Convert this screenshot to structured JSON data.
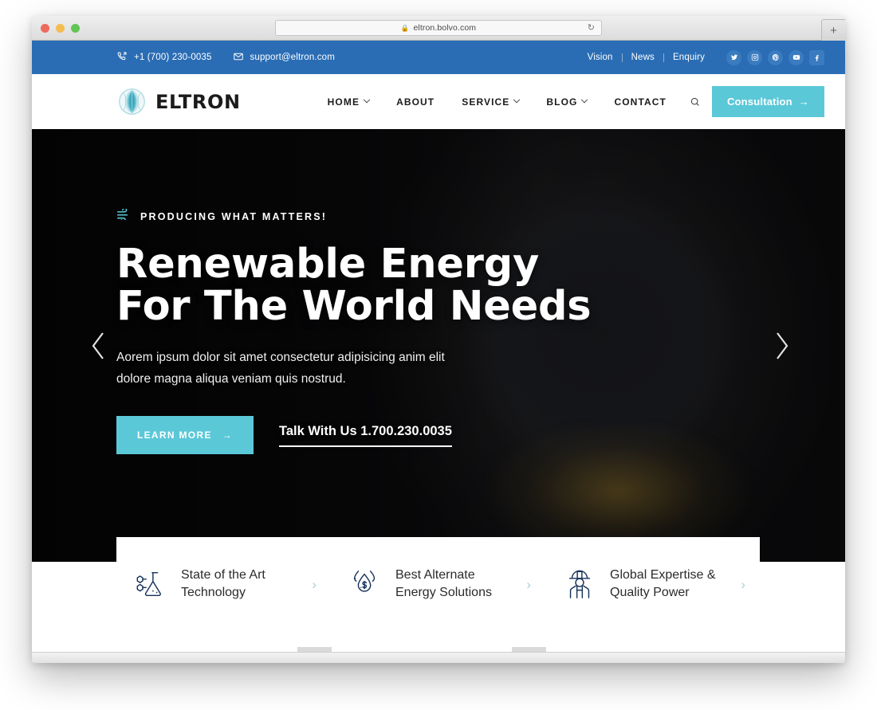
{
  "browser": {
    "url": "eltron.bolvo.com",
    "lock_icon": "lock-icon",
    "reload_icon": "reload-icon",
    "newtab_label": "+"
  },
  "topbar": {
    "phone": "+1 (700) 230-0035",
    "email": "support@eltron.com",
    "phone_icon": "phone-icon",
    "mail_icon": "mail-icon",
    "links": [
      "Vision",
      "News",
      "Enquiry"
    ],
    "socials": [
      "twitter-icon",
      "instagram-icon",
      "pinterest-icon",
      "youtube-icon",
      "facebook-icon"
    ],
    "bg_color": "#2a6db5"
  },
  "header": {
    "brand": "ELTRON",
    "brand_mark": "leaf-globe-logo",
    "nav": [
      {
        "label": "HOME",
        "has_dropdown": true
      },
      {
        "label": "ABOUT",
        "has_dropdown": false
      },
      {
        "label": "SERVICE",
        "has_dropdown": true
      },
      {
        "label": "BLOG",
        "has_dropdown": true
      },
      {
        "label": "CONTACT",
        "has_dropdown": false
      }
    ],
    "search_icon": "search-icon",
    "consult_label": "Consultation",
    "consult_arrow": "→",
    "accent_color": "#5bc8d8"
  },
  "hero": {
    "eyebrow": "PRODUCING WHAT MATTERS!",
    "eyebrow_icon": "wind-icon",
    "title_line1": "Renewable Energy",
    "title_line2": "For The World Needs",
    "description": "Aorem ipsum dolor sit amet consectetur adipisicing anim elit dolore magna aliqua veniam quis nostrud.",
    "learn_more_label": "LEARN MORE",
    "learn_more_arrow": "→",
    "talk_link": "Talk With Us 1.700.230.0035",
    "prev_arrow": "chevron-left-icon",
    "next_arrow": "chevron-right-icon"
  },
  "features": [
    {
      "icon": "flask-molecule-icon",
      "title": "State of the Art Technology",
      "chevron": "›"
    },
    {
      "icon": "water-drops-dollar-icon",
      "title": "Best Alternate Energy Solutions",
      "chevron": "›"
    },
    {
      "icon": "worker-hardhat-icon",
      "title": "Global Expertise & Quality Power",
      "chevron": "›"
    }
  ]
}
